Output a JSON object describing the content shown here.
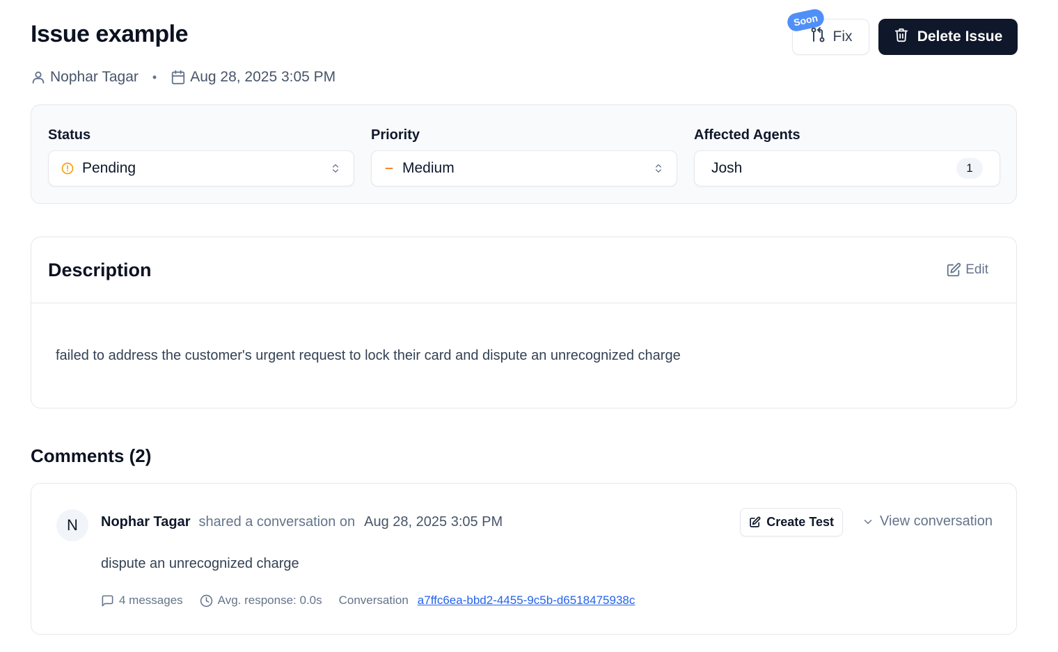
{
  "page": {
    "title": "Issue example",
    "author": "Nophar Tagar",
    "separator": "•",
    "created": "Aug 28, 2025 3:05 PM"
  },
  "header_actions": {
    "soon_badge": "Soon",
    "fix_label": "Fix",
    "delete_label": "Delete Issue"
  },
  "properties": {
    "status": {
      "label": "Status",
      "value": "Pending"
    },
    "priority": {
      "label": "Priority",
      "value": "Medium"
    },
    "agents": {
      "label": "Affected Agents",
      "value": "Josh",
      "count": "1"
    }
  },
  "description": {
    "title": "Description",
    "edit_label": "Edit",
    "text": "failed to address the customer's urgent request to lock their card and dispute an unrecognized charge"
  },
  "comments": {
    "title": "Comments (2)",
    "items": [
      {
        "avatar_initial": "N",
        "author": "Nophar Tagar",
        "action": "shared a conversation on",
        "date": "Aug 28, 2025 3:05 PM",
        "create_test_label": "Create Test",
        "view_conversation_label": "View conversation",
        "text": "dispute an unrecognized charge",
        "messages": "4 messages",
        "avg_response": "Avg. response: 0.0s",
        "conversation_label": "Conversation",
        "conversation_id": "a7ffc6ea-bbd2-4455-9c5b-d6518475938c"
      }
    ]
  },
  "colors": {
    "primary_dark": "#0f172a",
    "soon_badge": "#4f8ff7",
    "pending_amber": "#f59e0b",
    "medium_orange": "#f97316",
    "link_blue": "#2563eb"
  },
  "icons": [
    "user-icon",
    "calendar-icon",
    "git-pull-request-icon",
    "trash-icon",
    "alert-circle-icon",
    "minus-icon",
    "chevrons-up-down-icon",
    "edit-icon",
    "chevron-down-icon",
    "message-square-icon",
    "clock-icon"
  ]
}
